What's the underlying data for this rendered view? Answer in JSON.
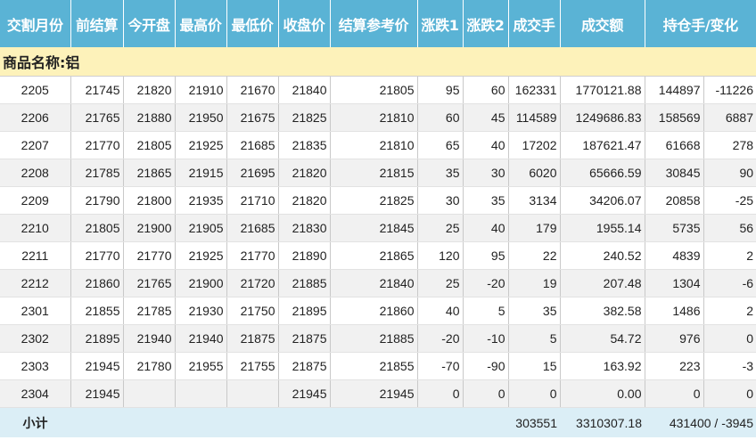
{
  "headers": [
    "交割月份",
    "前结算",
    "今开盘",
    "最高价",
    "最低价",
    "收盘价",
    "结算参考价",
    "涨跌1",
    "涨跌2",
    "成交手",
    "成交额",
    "持仓手/变化"
  ],
  "section_label": "商品名称:铝",
  "rows": [
    [
      "2205",
      "21745",
      "21820",
      "21910",
      "21670",
      "21840",
      "21805",
      "95",
      "60",
      "162331",
      "1770121.88",
      "144897",
      "-11226"
    ],
    [
      "2206",
      "21765",
      "21880",
      "21950",
      "21675",
      "21825",
      "21810",
      "60",
      "45",
      "114589",
      "1249686.83",
      "158569",
      "6887"
    ],
    [
      "2207",
      "21770",
      "21805",
      "21925",
      "21685",
      "21835",
      "21810",
      "65",
      "40",
      "17202",
      "187621.47",
      "61668",
      "278"
    ],
    [
      "2208",
      "21785",
      "21865",
      "21915",
      "21695",
      "21820",
      "21815",
      "35",
      "30",
      "6020",
      "65666.59",
      "30845",
      "90"
    ],
    [
      "2209",
      "21790",
      "21800",
      "21935",
      "21710",
      "21820",
      "21825",
      "30",
      "35",
      "3134",
      "34206.07",
      "20858",
      "-25"
    ],
    [
      "2210",
      "21805",
      "21900",
      "21905",
      "21685",
      "21830",
      "21845",
      "25",
      "40",
      "179",
      "1955.14",
      "5735",
      "56"
    ],
    [
      "2211",
      "21770",
      "21770",
      "21925",
      "21770",
      "21890",
      "21865",
      "120",
      "95",
      "22",
      "240.52",
      "4839",
      "2"
    ],
    [
      "2212",
      "21860",
      "21765",
      "21900",
      "21720",
      "21885",
      "21840",
      "25",
      "-20",
      "19",
      "207.48",
      "1304",
      "-6"
    ],
    [
      "2301",
      "21855",
      "21785",
      "21930",
      "21750",
      "21895",
      "21860",
      "40",
      "5",
      "35",
      "382.58",
      "1486",
      "2"
    ],
    [
      "2302",
      "21895",
      "21940",
      "21940",
      "21875",
      "21875",
      "21885",
      "-20",
      "-10",
      "5",
      "54.72",
      "976",
      "0"
    ],
    [
      "2303",
      "21945",
      "21780",
      "21955",
      "21755",
      "21875",
      "21855",
      "-70",
      "-90",
      "15",
      "163.92",
      "223",
      "-3"
    ],
    [
      "2304",
      "21945",
      "",
      "",
      "",
      "21945",
      "21945",
      "0",
      "0",
      "0",
      "0.00",
      "0",
      "0"
    ]
  ],
  "total": {
    "label": "小计",
    "volume": "303551",
    "turnover": "3310307.18",
    "open_interest": "431400 / -3945"
  },
  "colors": {
    "header_bg": "#5ab3d5",
    "section_bg": "#fdf2ba",
    "total_bg": "#dbeef6",
    "stripe_bg": "#f1f1f1"
  }
}
